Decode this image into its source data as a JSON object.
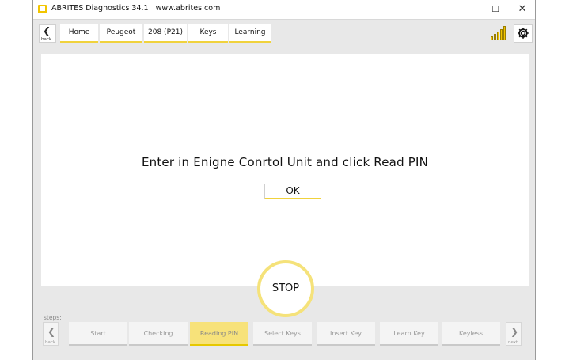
{
  "window": {
    "title": "ABRITES Diagnostics 34.1",
    "url": "www.abrites.com",
    "controls": {
      "minimize": "—",
      "maximize": "☐",
      "close": "✕"
    }
  },
  "nav": {
    "back_label": "back",
    "breadcrumbs": [
      "Home",
      "Peugeot",
      "208 (P21)",
      "Keys",
      "Learning"
    ]
  },
  "content": {
    "message": "Enter in Enigne Conrtol Unit and click Read PIN",
    "ok_label": "OK"
  },
  "stop_label": "STOP",
  "footer": {
    "steps_label": "steps:",
    "back_label": "back",
    "next_label": "next",
    "steps": [
      "Start",
      "Checking",
      "Reading PIN",
      "Select Keys",
      "Insert Key",
      "Learn Key",
      "Keyless"
    ],
    "active_step": "Reading PIN"
  },
  "colors": {
    "accent": "#f2c500",
    "active_step": "#f7e27a",
    "panel": "#e8e8e8"
  },
  "icons": {
    "signal": "signal-bars-icon",
    "settings": "gear-icon",
    "app": "abrites-logo-icon"
  }
}
